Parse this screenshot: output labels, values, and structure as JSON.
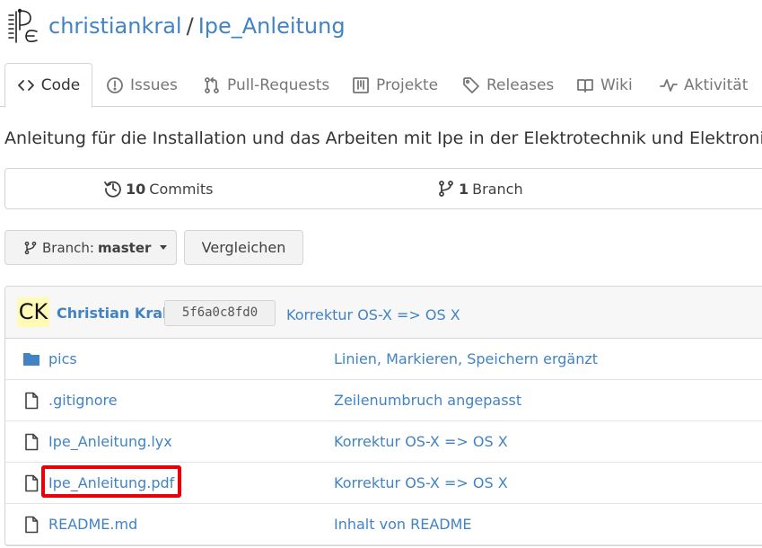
{
  "header": {
    "owner": "christiankral",
    "separator": "/",
    "repo": "Ipe_Anleitung"
  },
  "tabs": [
    {
      "label": "Code",
      "icon": "code-icon",
      "active": true
    },
    {
      "label": "Issues",
      "icon": "issue-icon"
    },
    {
      "label": "Pull-Requests",
      "icon": "pull-request-icon"
    },
    {
      "label": "Projekte",
      "icon": "project-icon"
    },
    {
      "label": "Releases",
      "icon": "tag-icon"
    },
    {
      "label": "Wiki",
      "icon": "book-icon"
    },
    {
      "label": "Aktivität",
      "icon": "pulse-icon"
    }
  ],
  "description": "Anleitung für die Installation und das Arbeiten mit Ipe in der Elektrotechnik und Elektronik",
  "stats": {
    "commits_count": "10",
    "commits_label": "Commits",
    "branch_count": "1",
    "branch_label": "Branch"
  },
  "branch_selector": {
    "prefix": "Branch:",
    "value": "master"
  },
  "compare_label": "Vergleichen",
  "latest_commit": {
    "avatar_initials": "CK",
    "author": "Christian Kral",
    "sha": "5f6a0c8fd0",
    "message": "Korrektur OS-X => OS X"
  },
  "files": [
    {
      "name": "pics",
      "type": "folder",
      "message": "Linien, Markieren, Speichern ergänzt"
    },
    {
      "name": ".gitignore",
      "type": "file",
      "message": "Zeilenumbruch angepasst"
    },
    {
      "name": "Ipe_Anleitung.lyx",
      "type": "file",
      "message": "Korrektur OS-X => OS X"
    },
    {
      "name": "Ipe_Anleitung.pdf",
      "type": "file",
      "message": "Korrektur OS-X => OS X"
    },
    {
      "name": "README.md",
      "type": "file",
      "message": "Inhalt von README"
    }
  ],
  "colors": {
    "link": "#4183c4",
    "highlight": "#e8000b",
    "folder": "#4183c4",
    "avatar_bg": "#fffbb7"
  }
}
